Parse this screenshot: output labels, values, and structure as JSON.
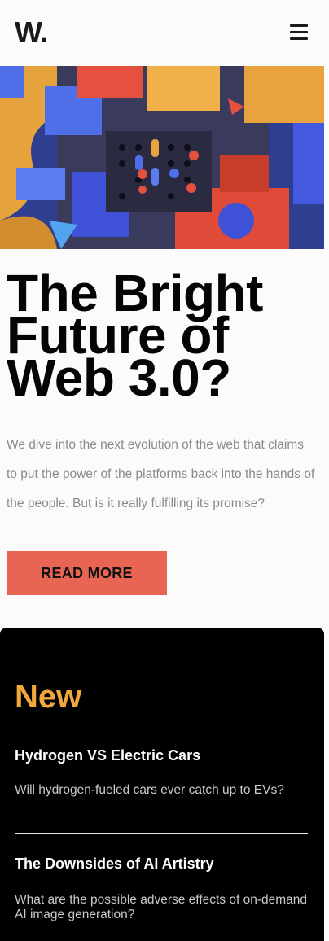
{
  "header": {
    "logo": "W.",
    "menu_icon": "hamburger-menu-icon"
  },
  "hero": {
    "image_alt_icon": "abstract-3d-blocks-image"
  },
  "article": {
    "headline": "The Bright Future of Web 3.0?",
    "description": "We dive into the next evolution of the web that claims to put the power of the platforms back into the hands of the people. But is it really fulfilling its promise?",
    "cta_label": "READ MORE"
  },
  "new_section": {
    "title": "New",
    "items": [
      {
        "title": "Hydrogen VS Electric Cars",
        "description": "Will hydrogen-fueled cars ever catch up to EVs?"
      },
      {
        "title": "The Downsides of AI Artistry",
        "description": "What are the possible adverse effects of on-demand AI image generation?"
      }
    ]
  },
  "colors": {
    "accent_orange": "#f0a83c",
    "button_red": "#e76552",
    "panel_black": "#000000",
    "text_gray": "#8a8a8a"
  }
}
